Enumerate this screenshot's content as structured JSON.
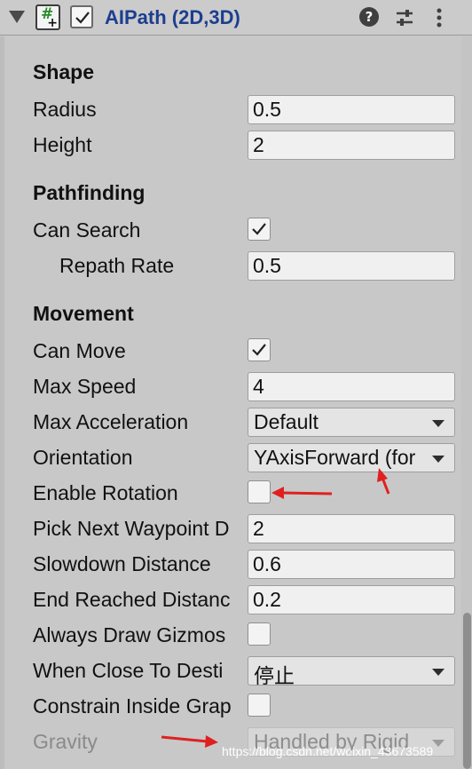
{
  "component": {
    "title": "AIPath (2D,3D)",
    "script_icon_glyph": "#",
    "enabled": true,
    "icons": [
      "fold-triangle-icon",
      "script-icon",
      "help-icon",
      "preset-icon",
      "context-menu-icon"
    ]
  },
  "sections": {
    "shape": "Shape",
    "pathfinding": "Pathfinding",
    "movement": "Movement"
  },
  "fields": {
    "radius": {
      "label": "Radius",
      "value": "0.5"
    },
    "height": {
      "label": "Height",
      "value": "2"
    },
    "can_search": {
      "label": "Can Search",
      "checked": true
    },
    "repath_rate": {
      "label": "Repath Rate",
      "value": "0.5"
    },
    "can_move": {
      "label": "Can Move",
      "checked": true
    },
    "max_speed": {
      "label": "Max Speed",
      "value": "4"
    },
    "max_acceleration": {
      "label": "Max Acceleration",
      "value": "Default"
    },
    "orientation": {
      "label": "Orientation",
      "value": "YAxisForward (for"
    },
    "enable_rotation": {
      "label": "Enable Rotation",
      "checked": false
    },
    "pick_next_waypoint": {
      "label": "Pick Next Waypoint D",
      "value": "2"
    },
    "slowdown_distance": {
      "label": "Slowdown Distance",
      "value": "0.6"
    },
    "end_reached_distance": {
      "label": "End Reached Distanc",
      "value": "0.2"
    },
    "always_draw_gizmos": {
      "label": "Always Draw Gizmos",
      "checked": false
    },
    "when_close_to_destination": {
      "label": "When Close To Desti",
      "value": "停止"
    },
    "constrain_inside_graph": {
      "label": "Constrain Inside Grap",
      "checked": false
    },
    "gravity": {
      "label": "Gravity",
      "value": "Handled by Rigid",
      "disabled": true
    }
  },
  "watermark": "https://blog.csdn.net/weixin_43673589",
  "colors": {
    "panel_bg": "#c8c8c8",
    "title_blue": "#1c3e8f",
    "annotation_red": "#e02020"
  }
}
